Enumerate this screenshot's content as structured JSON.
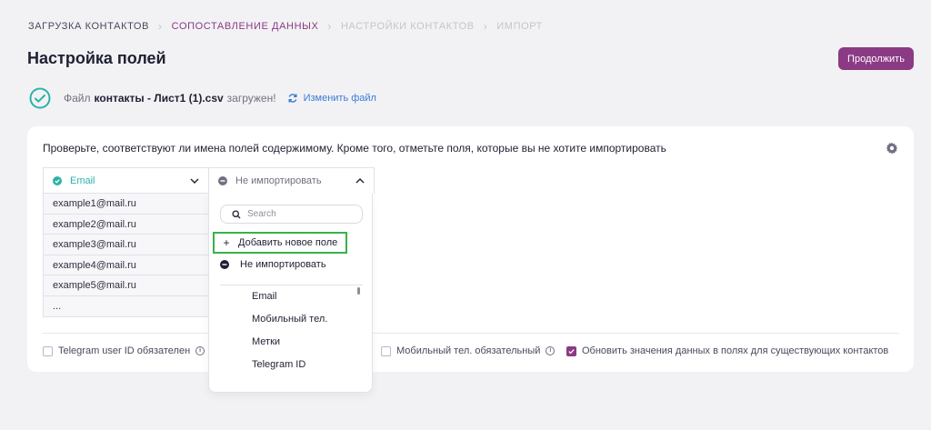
{
  "breadcrumb": {
    "steps": [
      "Загрузка контактов",
      "Сопоставление данных",
      "Настройки контактов",
      "Импорт"
    ]
  },
  "page": {
    "title": "Настройка полей",
    "continue_label": "Продолжить"
  },
  "file_status": {
    "prefix": "Файл",
    "file_name": "контакты - Лист1 (1).csv",
    "suffix": "загружен!",
    "change_label": "Изменить файл"
  },
  "card": {
    "hint": "Проверьте, соответствуют ли имена полей содержимому. Кроме того, отметьте поля, которые вы не хотите импортировать"
  },
  "columns": {
    "email_label": "Email",
    "email_values": [
      "example1@mail.ru",
      "example2@mail.ru",
      "example3@mail.ru",
      "example4@mail.ru",
      "example5@mail.ru",
      "..."
    ],
    "second_label": "Не импортировать"
  },
  "options": {
    "telegram_required": "Telegram user ID обязателен",
    "mobile_required": "Мобильный тел. обязательный",
    "update_existing": "Обновить значения данных в полях для существующих контактов",
    "update_existing_checked": true
  },
  "dropdown": {
    "search_placeholder": "Search",
    "add_new": "Добавить новое поле",
    "no_import": "Не импортировать",
    "items": [
      "Email",
      "Мобильный тел.",
      "Метки",
      "Telegram ID"
    ]
  },
  "colors": {
    "accent": "#8b3a84",
    "teal": "#2db2a8",
    "link": "#3b7bd6",
    "highlight": "#37b24a"
  }
}
